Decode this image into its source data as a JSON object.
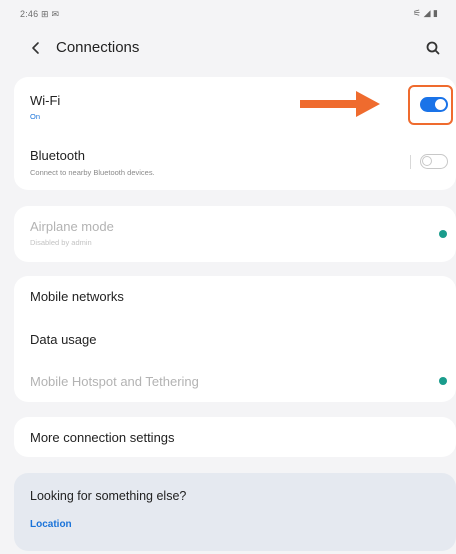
{
  "status_bar": {
    "time": "2:46 ⊞ ✉",
    "system": "⚟ ◢ ▮"
  },
  "header": {
    "title": "Connections"
  },
  "icons": {
    "back": "chevron-left-icon",
    "search": "search-icon"
  },
  "settings": {
    "wifi": {
      "label": "Wi-Fi",
      "status": "On",
      "enabled": true
    },
    "bluetooth": {
      "label": "Bluetooth",
      "description": "Connect to nearby Bluetooth devices.",
      "enabled": false
    },
    "airplane": {
      "label": "Airplane mode",
      "description": "Disabled by admin"
    },
    "mobile_networks": {
      "label": "Mobile networks"
    },
    "data_usage": {
      "label": "Data usage"
    },
    "hotspot": {
      "label": "Mobile Hotspot and Tethering"
    },
    "more": {
      "label": "More connection settings"
    }
  },
  "suggestion": {
    "title": "Looking for something else?",
    "link": "Location"
  },
  "colors": {
    "accent": "#1a73e8",
    "highlight": "#ef6b2e",
    "dot": "#1a9c8c"
  }
}
